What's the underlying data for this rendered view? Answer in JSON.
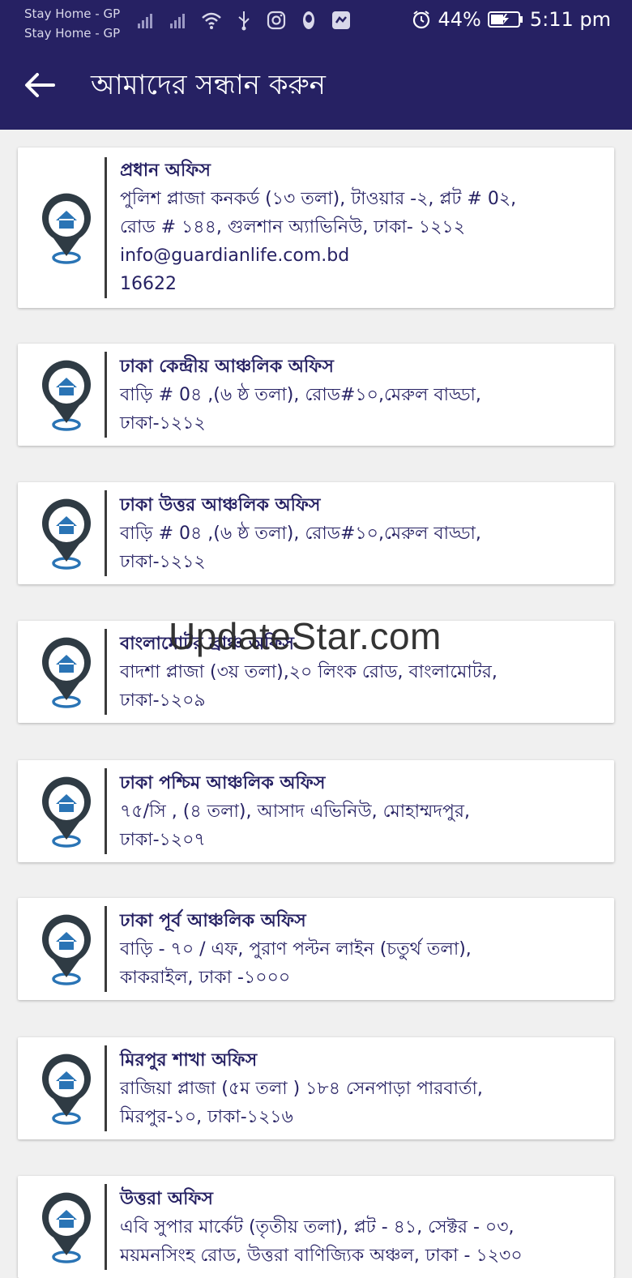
{
  "status_bar": {
    "carrier_line1": "Stay Home - GP",
    "carrier_line2": "Stay Home - GP",
    "battery": "44%",
    "time": "5:11 pm"
  },
  "header": {
    "title": "আমাদের সন্ধান করুন",
    "back_icon": "arrow-left-icon"
  },
  "offices": [
    {
      "name": "প্রধান অফিস",
      "lines": [
        "পুলিশ প্লাজা কনকর্ড (১৩ তলা), টাওয়ার -২, প্লট # 0২,",
        "রোড # ১৪৪, গুলশান অ্যাভিনিউ, ঢাকা- ১২১২",
        "info@guardianlife.com.bd",
        "16622"
      ]
    },
    {
      "name": "ঢাকা কেন্দ্রীয় আঞ্চলিক অফিস",
      "lines": [
        "বাড়ি # 0৪ ,(৬ ষ্ঠ তলা), রোড#১০,মেরুল বাড্ডা,",
        "ঢাকা-১২১২"
      ]
    },
    {
      "name": "ঢাকা উত্তর আঞ্চলিক অফিস",
      "lines": [
        "বাড়ি # 0৪ ,(৬ ষ্ঠ তলা), রোড#১০,মেরুল বাড্ডা,",
        "ঢাকা-১২১২"
      ]
    },
    {
      "name": "বাংলামোটর ব্রাঞ্চ অফিস",
      "lines": [
        "বাদশা প্লাজা (৩য় তলা),২০ লিংক রোড, বাংলামোটর,",
        "ঢাকা-১২০৯"
      ]
    },
    {
      "name": "ঢাকা পশ্চিম আঞ্চলিক অফিস",
      "lines": [
        "৭৫/সি , (৪ তলা), আসাদ এভিনিউ, মোহাম্মদপুর,",
        "ঢাকা-১২০৭"
      ]
    },
    {
      "name": "ঢাকা পূর্ব আঞ্চলিক অফিস",
      "lines": [
        "বাড়ি - ৭০ / এফ, পুরাণ পল্টন লাইন (চতুর্থ তলা),",
        "কাকরাইল, ঢাকা -১০০০"
      ]
    },
    {
      "name": "মিরপুর শাখা অফিস",
      "lines": [
        "রাজিয়া প্লাজা (৫ম তলা ) ১৮৪ সেনপাড়া পারবার্তা,",
        "মিরপুর-১০, ঢাকা-১২১৬"
      ]
    },
    {
      "name": "উত্তরা অফিস",
      "lines": [
        "এবি সুপার মার্কেট (তৃতীয় তলা), প্লট - ৪১, সেক্টর - ০৩,",
        "ময়মনসিংহ রোড, উত্তরা বাণিজ্যিক অঞ্চল, ঢাকা - ১২৩০"
      ]
    }
  ],
  "watermark": "UpdateStar.com",
  "colors": {
    "primary": "#262163",
    "background": "#f0f0f0",
    "card": "#ffffff",
    "pin_ring": "#2f3b44",
    "pin_house": "#2a74b5"
  }
}
